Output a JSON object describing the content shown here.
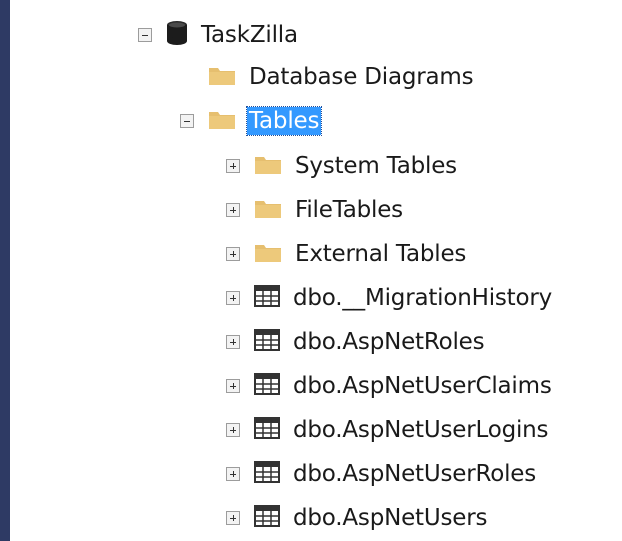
{
  "tree": {
    "database": {
      "label": "TaskZilla",
      "icon": "database-icon",
      "expanded": true
    },
    "database_diagrams": {
      "label": "Database Diagrams",
      "icon": "folder-icon"
    },
    "tables": {
      "label": "Tables",
      "icon": "folder-icon",
      "expanded": true,
      "selected": true
    },
    "children": [
      {
        "label": "System Tables",
        "icon": "folder-icon",
        "expanded": false
      },
      {
        "label": "FileTables",
        "icon": "folder-icon",
        "expanded": false
      },
      {
        "label": "External Tables",
        "icon": "folder-icon",
        "expanded": false
      },
      {
        "label": "dbo.__MigrationHistory",
        "icon": "table-icon",
        "expanded": false
      },
      {
        "label": "dbo.AspNetRoles",
        "icon": "table-icon",
        "expanded": false
      },
      {
        "label": "dbo.AspNetUserClaims",
        "icon": "table-icon",
        "expanded": false
      },
      {
        "label": "dbo.AspNetUserLogins",
        "icon": "table-icon",
        "expanded": false
      },
      {
        "label": "dbo.AspNetUserRoles",
        "icon": "table-icon",
        "expanded": false
      },
      {
        "label": "dbo.AspNetUsers",
        "icon": "table-icon",
        "expanded": false
      }
    ]
  },
  "colors": {
    "selection": "#3399ff",
    "folder": "#e6bf6f",
    "sidebar": "#2e3a64"
  }
}
